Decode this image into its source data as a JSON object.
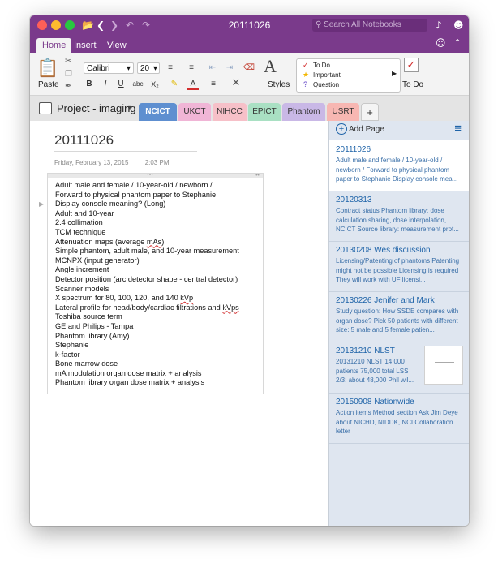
{
  "window": {
    "title": "20111026"
  },
  "search": {
    "placeholder": "Search All Notebooks"
  },
  "ribbon_tabs": [
    "Home",
    "Insert",
    "View"
  ],
  "ribbon": {
    "paste_label": "Paste",
    "font_name": "Calibri",
    "font_size": "20",
    "styles_label": "Styles",
    "tags": [
      "To Do",
      "Important",
      "Question"
    ],
    "todo_label": "To Do"
  },
  "notebook": {
    "name": "Project - imaging"
  },
  "sections": [
    "NCICT",
    "UKCT",
    "NIHCC",
    "EPICT",
    "Phantom",
    "USRT"
  ],
  "page": {
    "title": "20111026",
    "date": "Friday, February 13, 2015",
    "time": "2:03 PM",
    "lines": [
      "Adult male and female / 10-year-old / newborn /",
      "Forward to physical phantom paper to Stephanie",
      "Display console meaning? (Long)",
      "Adult and 10-year",
      "2.4 collimation",
      "TCM technique",
      "Attenuation maps (average mAs)",
      "Simple phantom, adult male, and 10-year measurement",
      "MCNPX (input generator)",
      "Angle increment",
      "Detector position (arc detector shape - central detector)",
      "Scanner models",
      "X spectrum for 80, 100, 120, and 140 kVp",
      "Lateral profile for head/body/cardiac filtrations and kVps",
      "Toshiba source term",
      "GE and Philips - Tampa",
      "Phantom library (Amy)",
      "Stephanie",
      "k-factor",
      "Bone marrow dose",
      "mA modulation organ dose matrix + analysis",
      "Phantom library organ dose matrix + analysis"
    ]
  },
  "page_list": {
    "add_label": "Add Page",
    "items": [
      {
        "title": "20111026",
        "preview": "Adult male and female / 10-year-old / newborn /  Forward to physical phantom paper to Stephanie  Display console mea..."
      },
      {
        "title": "20120313",
        "preview": "Contract status  Phantom library: dose calculation sharing, dose interpolation, NCICT  Source library: measurement prot..."
      },
      {
        "title": "20130208 Wes discussion",
        "preview": "Licensing/Patenting of phantoms  Patenting might not be possible  Licensing is required  They will work with UF licensi..."
      },
      {
        "title": "20130226 Jenifer and Mark",
        "preview": "Study question: How SSDE compares with organ dose?  Pick 50 patients with different size: 5 male and 5 female patien..."
      },
      {
        "title": "20131210 NLST",
        "preview": "20131210 NLST  14,000 patients  75,000 total  LSS 2/3: about 48,000  Phil wil..."
      },
      {
        "title": "20150908 Nationwide",
        "preview": "Action items  Method section  Ask Jim Deye about NICHD, NIDDK, NCI  Collaboration letter"
      }
    ]
  },
  "colors": {
    "accent": "#7a3a8b",
    "sections": [
      "#5e8fd0",
      "#f0b5d6",
      "#f6c0c8",
      "#a9e0c3",
      "#c9b8e6",
      "#f7b7b2"
    ]
  }
}
